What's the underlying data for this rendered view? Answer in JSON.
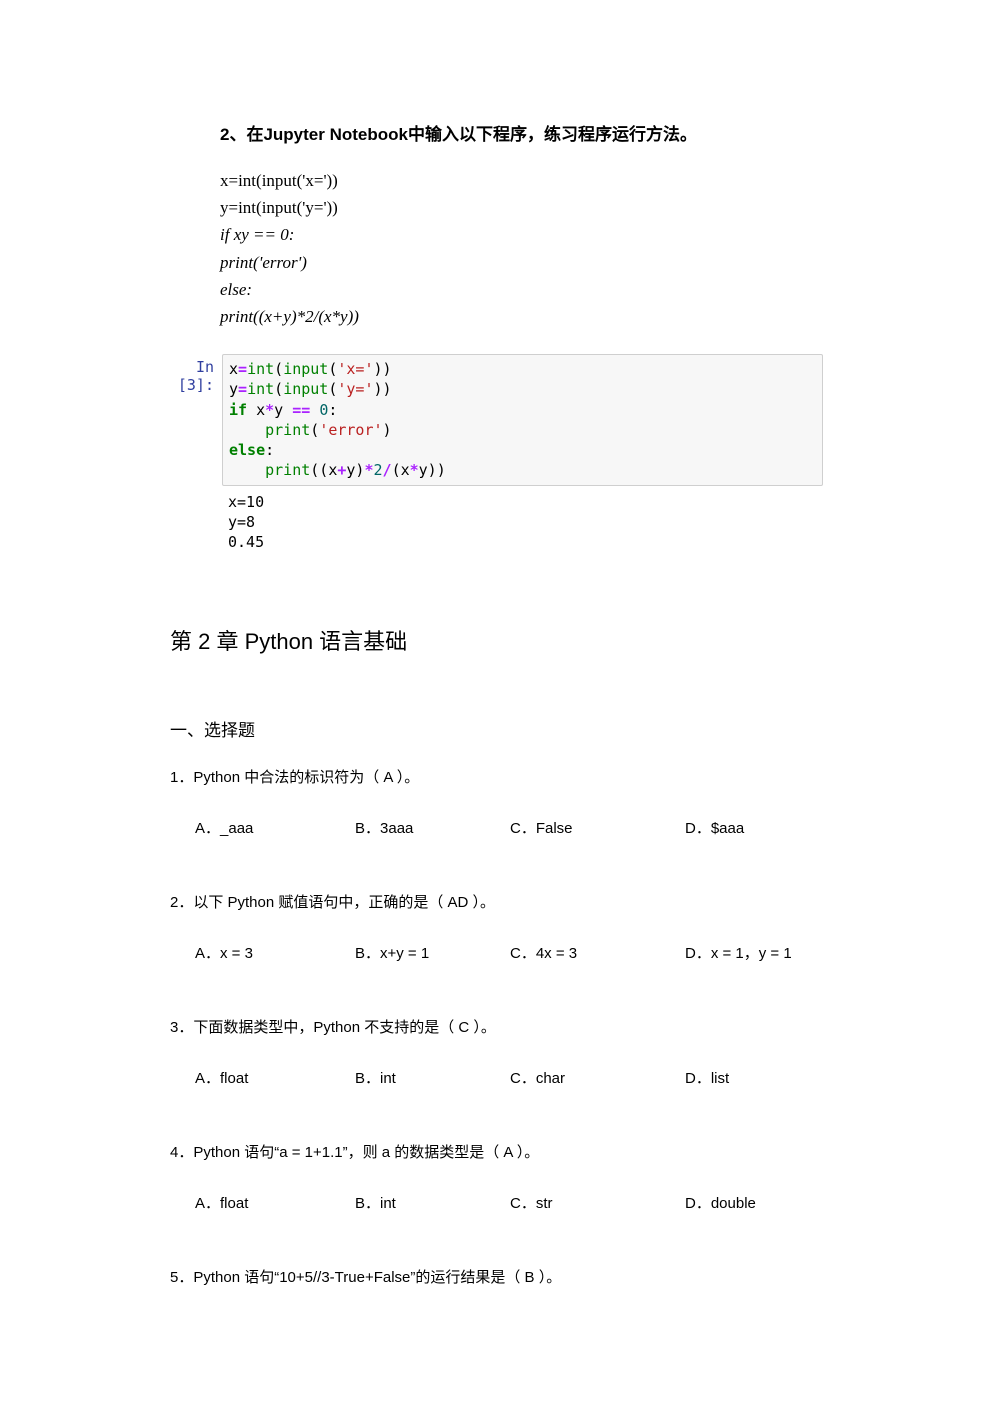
{
  "exercise2": {
    "title": "2、在Jupyter Notebook中输入以下程序，练习程序运行方法。",
    "pseudo": {
      "l1": "x=int(input('x='))",
      "l2": "y=int(input('y='))",
      "l3": "if xy == 0:",
      "l4": "print('error')",
      "l5": "else:",
      "l6": "print((x+y)*2/(x*y))"
    },
    "prompt": "In  [3]:",
    "code_tokens": {
      "c1_a": "x",
      "c1_eq": "=",
      "c1_int": "int",
      "c1_p1": "(",
      "c1_inp": "input",
      "c1_p2": "(",
      "c1_s": "'x='",
      "c1_p3": "))",
      "c2_a": "y",
      "c2_eq": "=",
      "c2_int": "int",
      "c2_p1": "(",
      "c2_inp": "input",
      "c2_p2": "(",
      "c2_s": "'y='",
      "c2_p3": "))",
      "c3_if": "if ",
      "c3_x": "x",
      "c3_mul": "*",
      "c3_y": "y ",
      "c3_eqeq": "== ",
      "c3_zero": "0",
      "c3_col": ":",
      "c4_pad": "    ",
      "c4_print": "print",
      "c4_p1": "(",
      "c4_s": "'error'",
      "c4_p2": ")",
      "c5_else": "else",
      "c5_col": ":",
      "c6_pad": "    ",
      "c6_print": "print",
      "c6_p1": "((x",
      "c6_plus": "+",
      "c6_y": "y)",
      "c6_mul": "*",
      "c6_two": "2",
      "c6_div": "/",
      "c6_p2": "(x",
      "c6_mul2": "*",
      "c6_p3": "y))"
    },
    "output": {
      "l1": "x=10",
      "l2": "y=8",
      "l3": "0.45"
    }
  },
  "chapter": "第 2 章  Python 语言基础",
  "section1": "一、选择题",
  "q1": {
    "stem": "1．Python 中合法的标识符为（  A  ）。",
    "a": "A．_aaa",
    "b": "B．3aaa",
    "c": "C．False",
    "d": "D．$aaa"
  },
  "q2": {
    "stem": "2．以下 Python 赋值语句中，正确的是（  AD  ）。",
    "a": "A．x = 3",
    "b": "B．x+y = 1",
    "c": "C．4x = 3",
    "d": "D．x = 1，y = 1"
  },
  "q3": {
    "stem": "3．下面数据类型中，Python 不支持的是（  C  ）。",
    "a": "A．float",
    "b": "B．int",
    "c": "C．char",
    "d": "D．list"
  },
  "q4": {
    "stem": "4．Python 语句“a = 1+1.1”，则 a 的数据类型是（  A  ）。",
    "a": "A．float",
    "b": "B．int",
    "c": "C．str",
    "d": "D．double"
  },
  "q5": {
    "stem": "5．Python 语句“10+5//3-True+False”的运行结果是（  B  ）。"
  }
}
